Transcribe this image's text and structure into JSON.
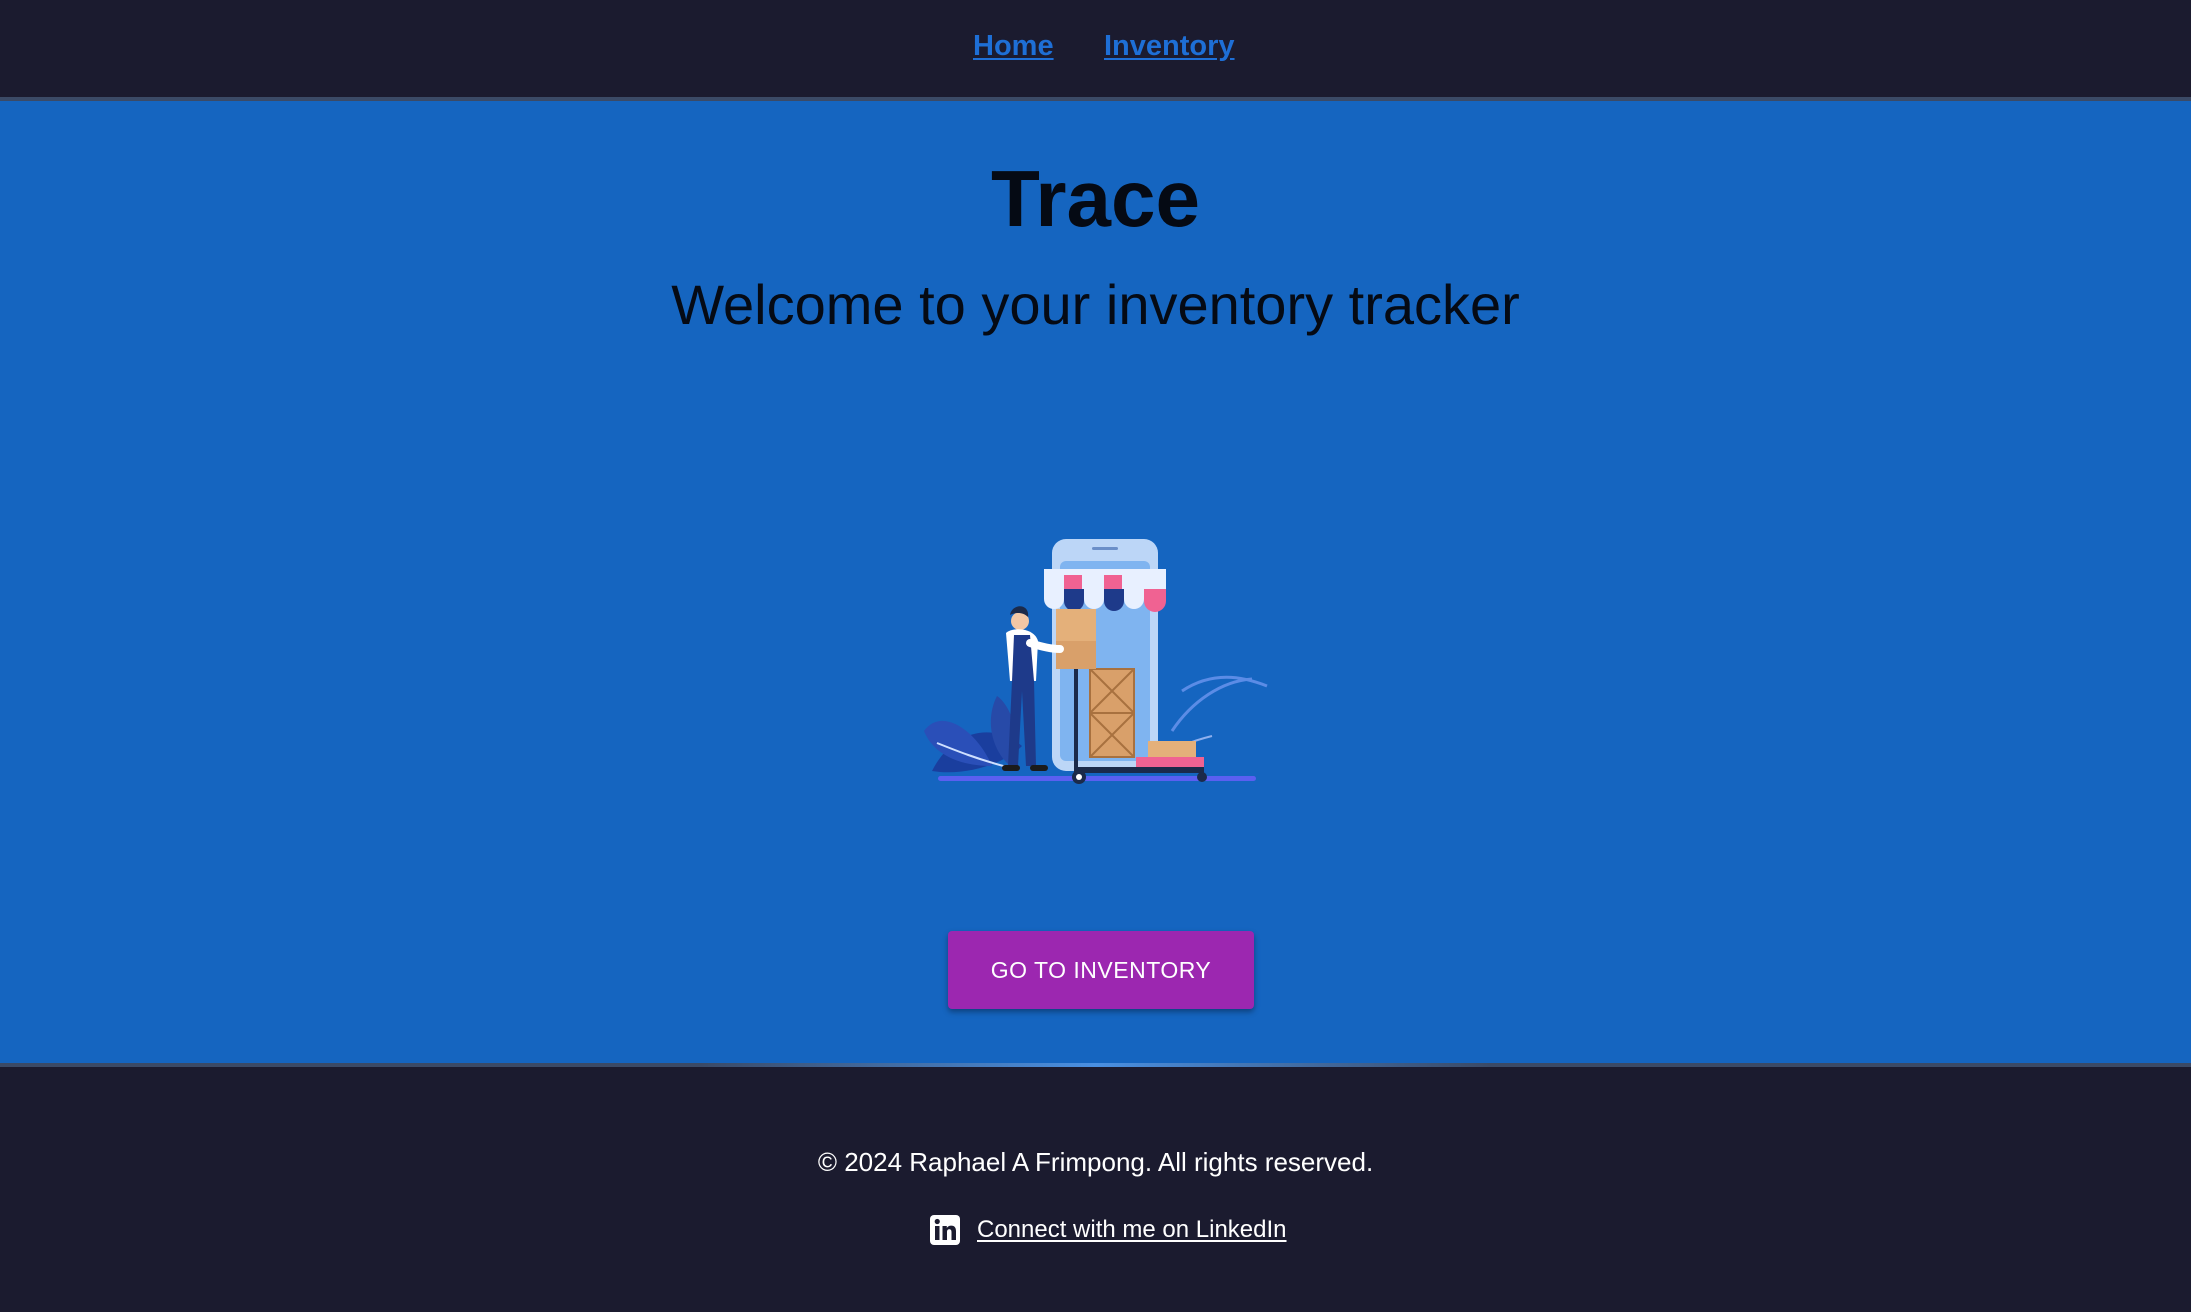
{
  "nav": {
    "home_label": "Home",
    "inventory_label": "Inventory"
  },
  "hero": {
    "title": "Trace",
    "subtitle": "Welcome to your inventory tracker",
    "cta_label": "GO TO INVENTORY"
  },
  "footer": {
    "copyright": "© 2024 Raphael A Frimpong. All rights reserved.",
    "linkedin_label": "Connect with me on LinkedIn",
    "linkedin_icon": "linkedin-icon"
  },
  "colors": {
    "nav_background": "#1b1b2f",
    "hero_background": "#1565c0",
    "nav_link": "#1e6fd6",
    "cta_button": "#9c27b0",
    "footer_text": "#ffffff"
  },
  "illustration": {
    "icon": "warehouse-worker-with-mobile-store-illustration"
  }
}
